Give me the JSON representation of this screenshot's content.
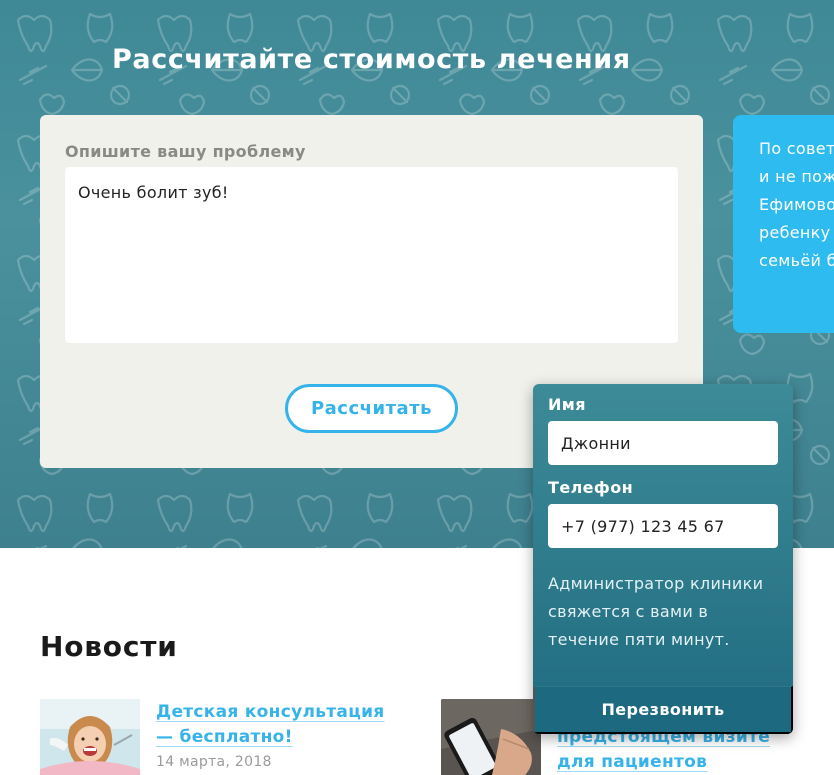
{
  "hero": {
    "title": "Рассчитайте стоимость лечения"
  },
  "calculator": {
    "label": "Опишите вашу проблему",
    "textarea_value": "Очень болит зуб!",
    "submit_label": "Рассчитать"
  },
  "advice": {
    "lines": [
      "По совет",
      "и не пож",
      "Ефимово",
      "ребенку",
      "семьёй б"
    ]
  },
  "callback": {
    "name_label": "Имя",
    "name_value": "Джонни",
    "phone_label": "Телефон",
    "phone_value": "+7 (977) 123 45 67",
    "note": "Администратор клиники свяжется с вами в течение пяти минут.",
    "button_label": "Перезвонить"
  },
  "news": {
    "title": "Новости",
    "items": [
      {
        "title": "Детская консультация — бесплатно!",
        "date": "14 марта, 2018"
      },
      {
        "title": "предстоящем визите для пациентов"
      }
    ]
  },
  "colors": {
    "accent": "#36b3e8",
    "hero_bg": "#4a919d",
    "panel_bg": "#2d7a8b",
    "advice_bg": "#2ebcf0"
  }
}
